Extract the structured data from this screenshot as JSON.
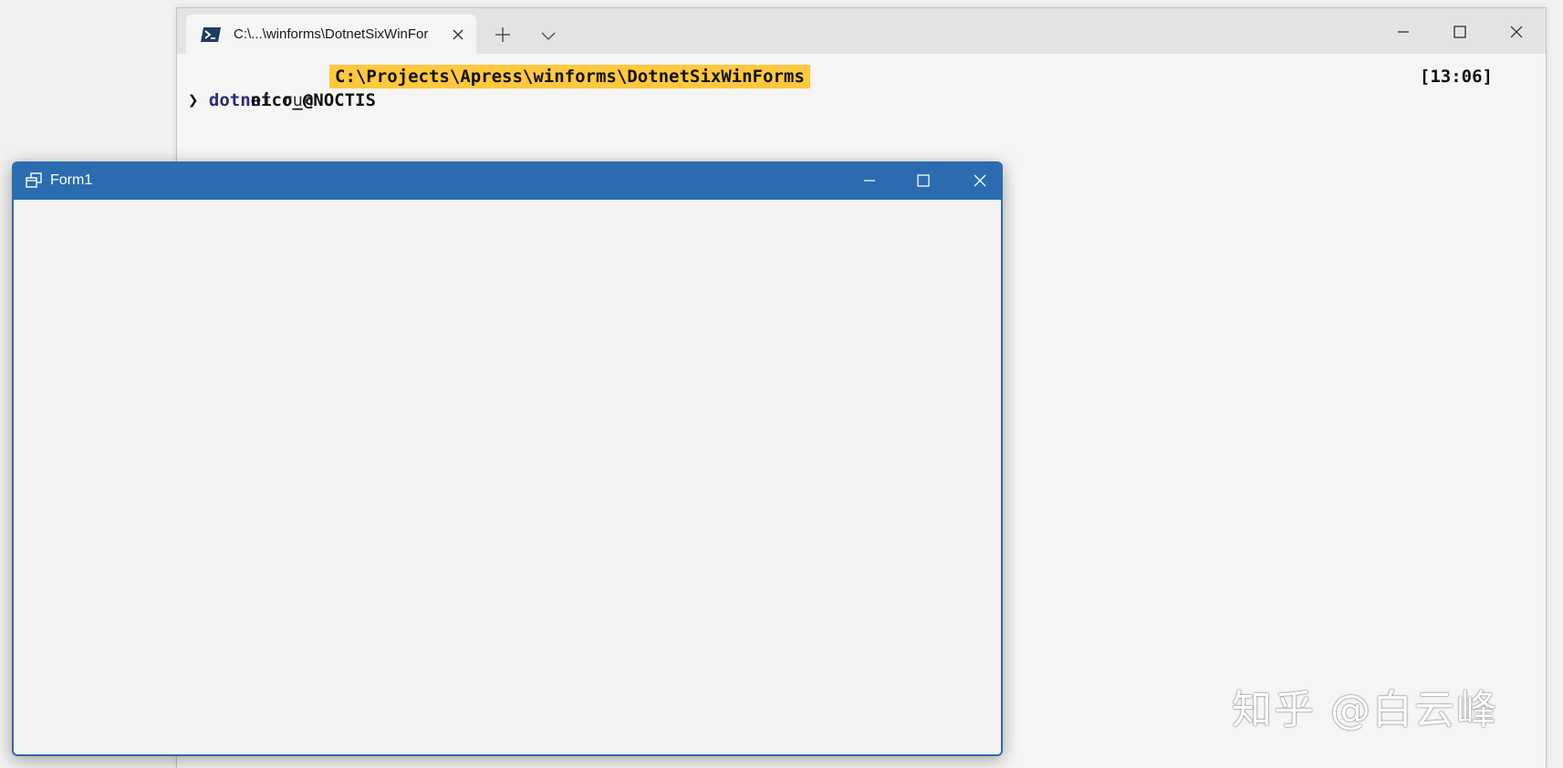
{
  "terminal": {
    "tab": {
      "title": "C:\\...\\winforms\\DotnetSixWinFor",
      "icon": "powershell-icon"
    },
    "new_tab_symbol": "+",
    "controls": [
      "minimize-icon",
      "maximize-icon",
      "close-icon"
    ],
    "prompt": {
      "user": "nico_@NOCTIS",
      "path": "C:\\Projects\\Apress\\winforms\\DotnetSixWinForms",
      "time": "[13:06]",
      "path_color": "#ffc83d"
    },
    "command": {
      "chevron": "❯",
      "name": "dotnet",
      "arg": "run"
    }
  },
  "form": {
    "title": "Form1",
    "titlebar_color": "#2b6cb0",
    "icon": "form-app-icon",
    "controls": [
      "minimize-icon",
      "maximize-icon",
      "close-icon"
    ]
  },
  "watermark": {
    "text": "知乎 @白云峰"
  }
}
